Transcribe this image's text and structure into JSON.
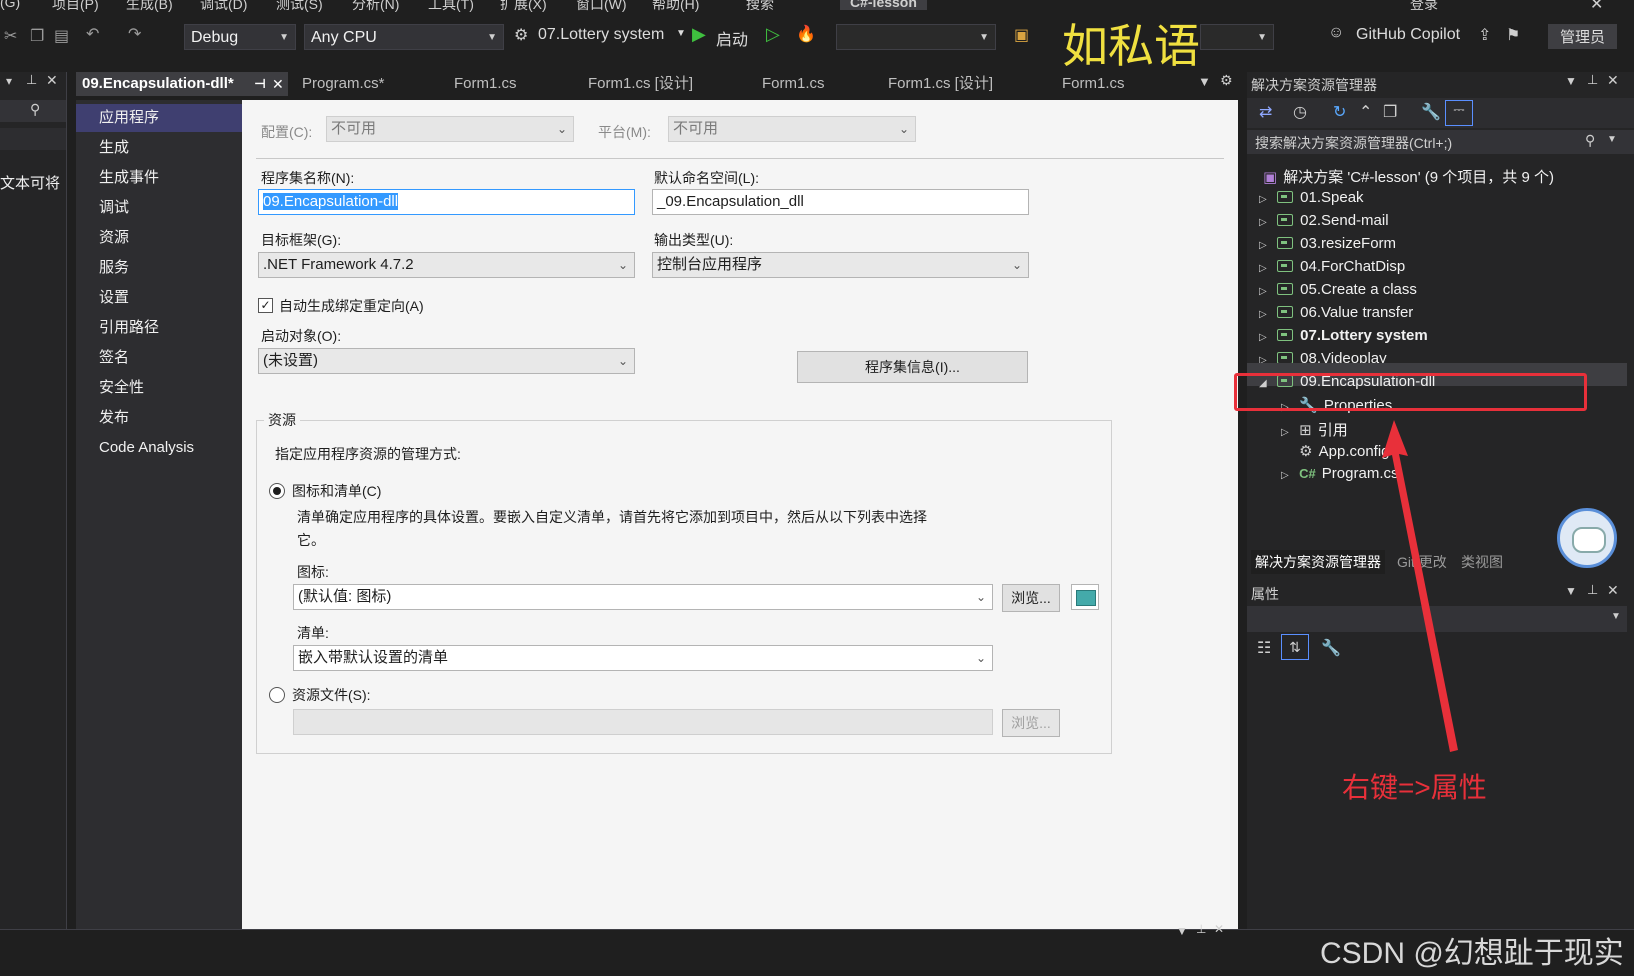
{
  "menu": [
    "(G)",
    "项目(P)",
    "生成(B)",
    "调试(D)",
    "测试(S)",
    "分析(N)",
    "工具(T)",
    "扩展(X)",
    "窗口(W)",
    "帮助(H)",
    "搜索",
    "C#-lesson",
    "登录"
  ],
  "toolbar": {
    "config": "Debug",
    "platform": "Any CPU",
    "startup_project": "07.Lottery system",
    "start_label": "启动",
    "overlay_text": "如私语",
    "copilot": "GitHub Copilot",
    "admin": "管理员"
  },
  "left_panel": {
    "text": "文本可将"
  },
  "tabs": [
    "09.Encapsulation-dll*",
    "Program.cs*",
    "Form1.cs",
    "Form1.cs [设计]",
    "Form1.cs",
    "Form1.cs [设计]",
    "Form1.cs"
  ],
  "categories": [
    "应用程序",
    "生成",
    "生成事件",
    "调试",
    "资源",
    "服务",
    "设置",
    "引用路径",
    "签名",
    "安全性",
    "发布",
    "Code Analysis"
  ],
  "app_page": {
    "config_label": "配置(C):",
    "config_value": "不可用",
    "platform_label": "平台(M):",
    "platform_value": "不可用",
    "assembly_name_label": "程序集名称(N):",
    "assembly_name": "09.Encapsulation-dll",
    "namespace_label": "默认命名空间(L):",
    "namespace": "_09.Encapsulation_dll",
    "framework_label": "目标框架(G):",
    "framework": ".NET Framework 4.7.2",
    "output_type_label": "输出类型(U):",
    "output_type": "控制台应用程序",
    "auto_binding": "自动生成绑定重定向(A)",
    "startup_label": "启动对象(O):",
    "startup_value": "(未设置)",
    "assembly_info_button": "程序集信息(I)...",
    "resources_group": "资源",
    "resources_desc": "指定应用程序资源的管理方式:",
    "radio_icon_manifest": "图标和清单(C)",
    "manifest_desc_1": "清单确定应用程序的具体设置。要嵌入自定义清单，请首先将它添加到项目中，然后从以下列表中选择",
    "manifest_desc_2": "它。",
    "icon_label": "图标:",
    "icon_value": "(默认值: 图标)",
    "browse": "浏览...",
    "manifest_label": "清单:",
    "manifest_value": "嵌入带默认设置的清单",
    "radio_resource_file": "资源文件(S):",
    "browse_disabled": "浏览..."
  },
  "solution_explorer": {
    "title": "解决方案资源管理器",
    "search_placeholder": "搜索解决方案资源管理器(Ctrl+;)",
    "solution": "解决方案 'C#-lesson' (9 个项目，共 9 个)",
    "projects": [
      "01.Speak",
      "02.Send-mail",
      "03.resizeForm",
      "04.ForChatDisp",
      "05.Create a class",
      "06.Value transfer",
      "07.Lottery system",
      "08.Videoplay",
      "09.Encapsulation-dll"
    ],
    "children": [
      "Properties",
      "引用",
      "App.config",
      "Program.cs"
    ],
    "bottom_tabs": [
      "解决方案资源管理器",
      "Git 更改",
      "类视图"
    ]
  },
  "properties_panel": {
    "title": "属性"
  },
  "annotation": {
    "text": "右键=>属性",
    "color": "#e8303a"
  },
  "watermark": "CSDN @幻想趾于现实"
}
